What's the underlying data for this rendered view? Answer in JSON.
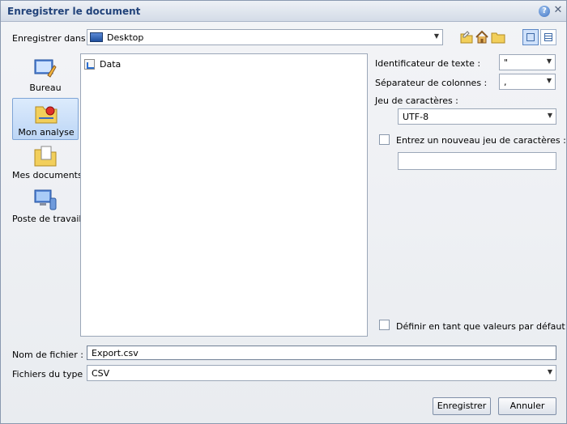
{
  "dialog": {
    "title": "Enregistrer le document",
    "help_glyph": "?",
    "close_glyph": "✕"
  },
  "save_in": {
    "label": "Enregistrer dans :",
    "value": "Desktop"
  },
  "toolbar_icons": [
    "new-folder-icon",
    "home-icon",
    "folder-icon",
    "thumbnail-view-icon",
    "list-view-icon"
  ],
  "places": [
    {
      "label": "Bureau",
      "icon": "desktop-icon",
      "selected": false
    },
    {
      "label": "Mon analyse",
      "icon": "my-analysis-icon",
      "selected": true
    },
    {
      "label": "Mes documents",
      "icon": "my-documents-icon",
      "selected": false
    },
    {
      "label": "Poste de travail",
      "icon": "workstation-icon",
      "selected": false
    }
  ],
  "files": [
    {
      "name": "Data"
    }
  ],
  "options": {
    "text_identifier_label": "Identificateur de texte :",
    "text_identifier_value": "\"",
    "column_separator_label": "Séparateur de colonnes :",
    "column_separator_value": ",",
    "charset_label": "Jeu de caractères :",
    "charset_value": "UTF-8",
    "new_charset_label": "Entrez un nouveau jeu de caractères :",
    "new_charset_value": "",
    "default_label": "Définir en tant que valeurs par défaut"
  },
  "filename": {
    "label": "Nom de fichier :",
    "value": "Export.csv"
  },
  "filetype": {
    "label": "Fichiers du type :",
    "value": "CSV"
  },
  "buttons": {
    "save": "Enregistrer",
    "cancel": "Annuler"
  },
  "colors": {
    "title_text": "#22437a",
    "selection": "#bdd6f6",
    "border": "#9ba7b8"
  }
}
